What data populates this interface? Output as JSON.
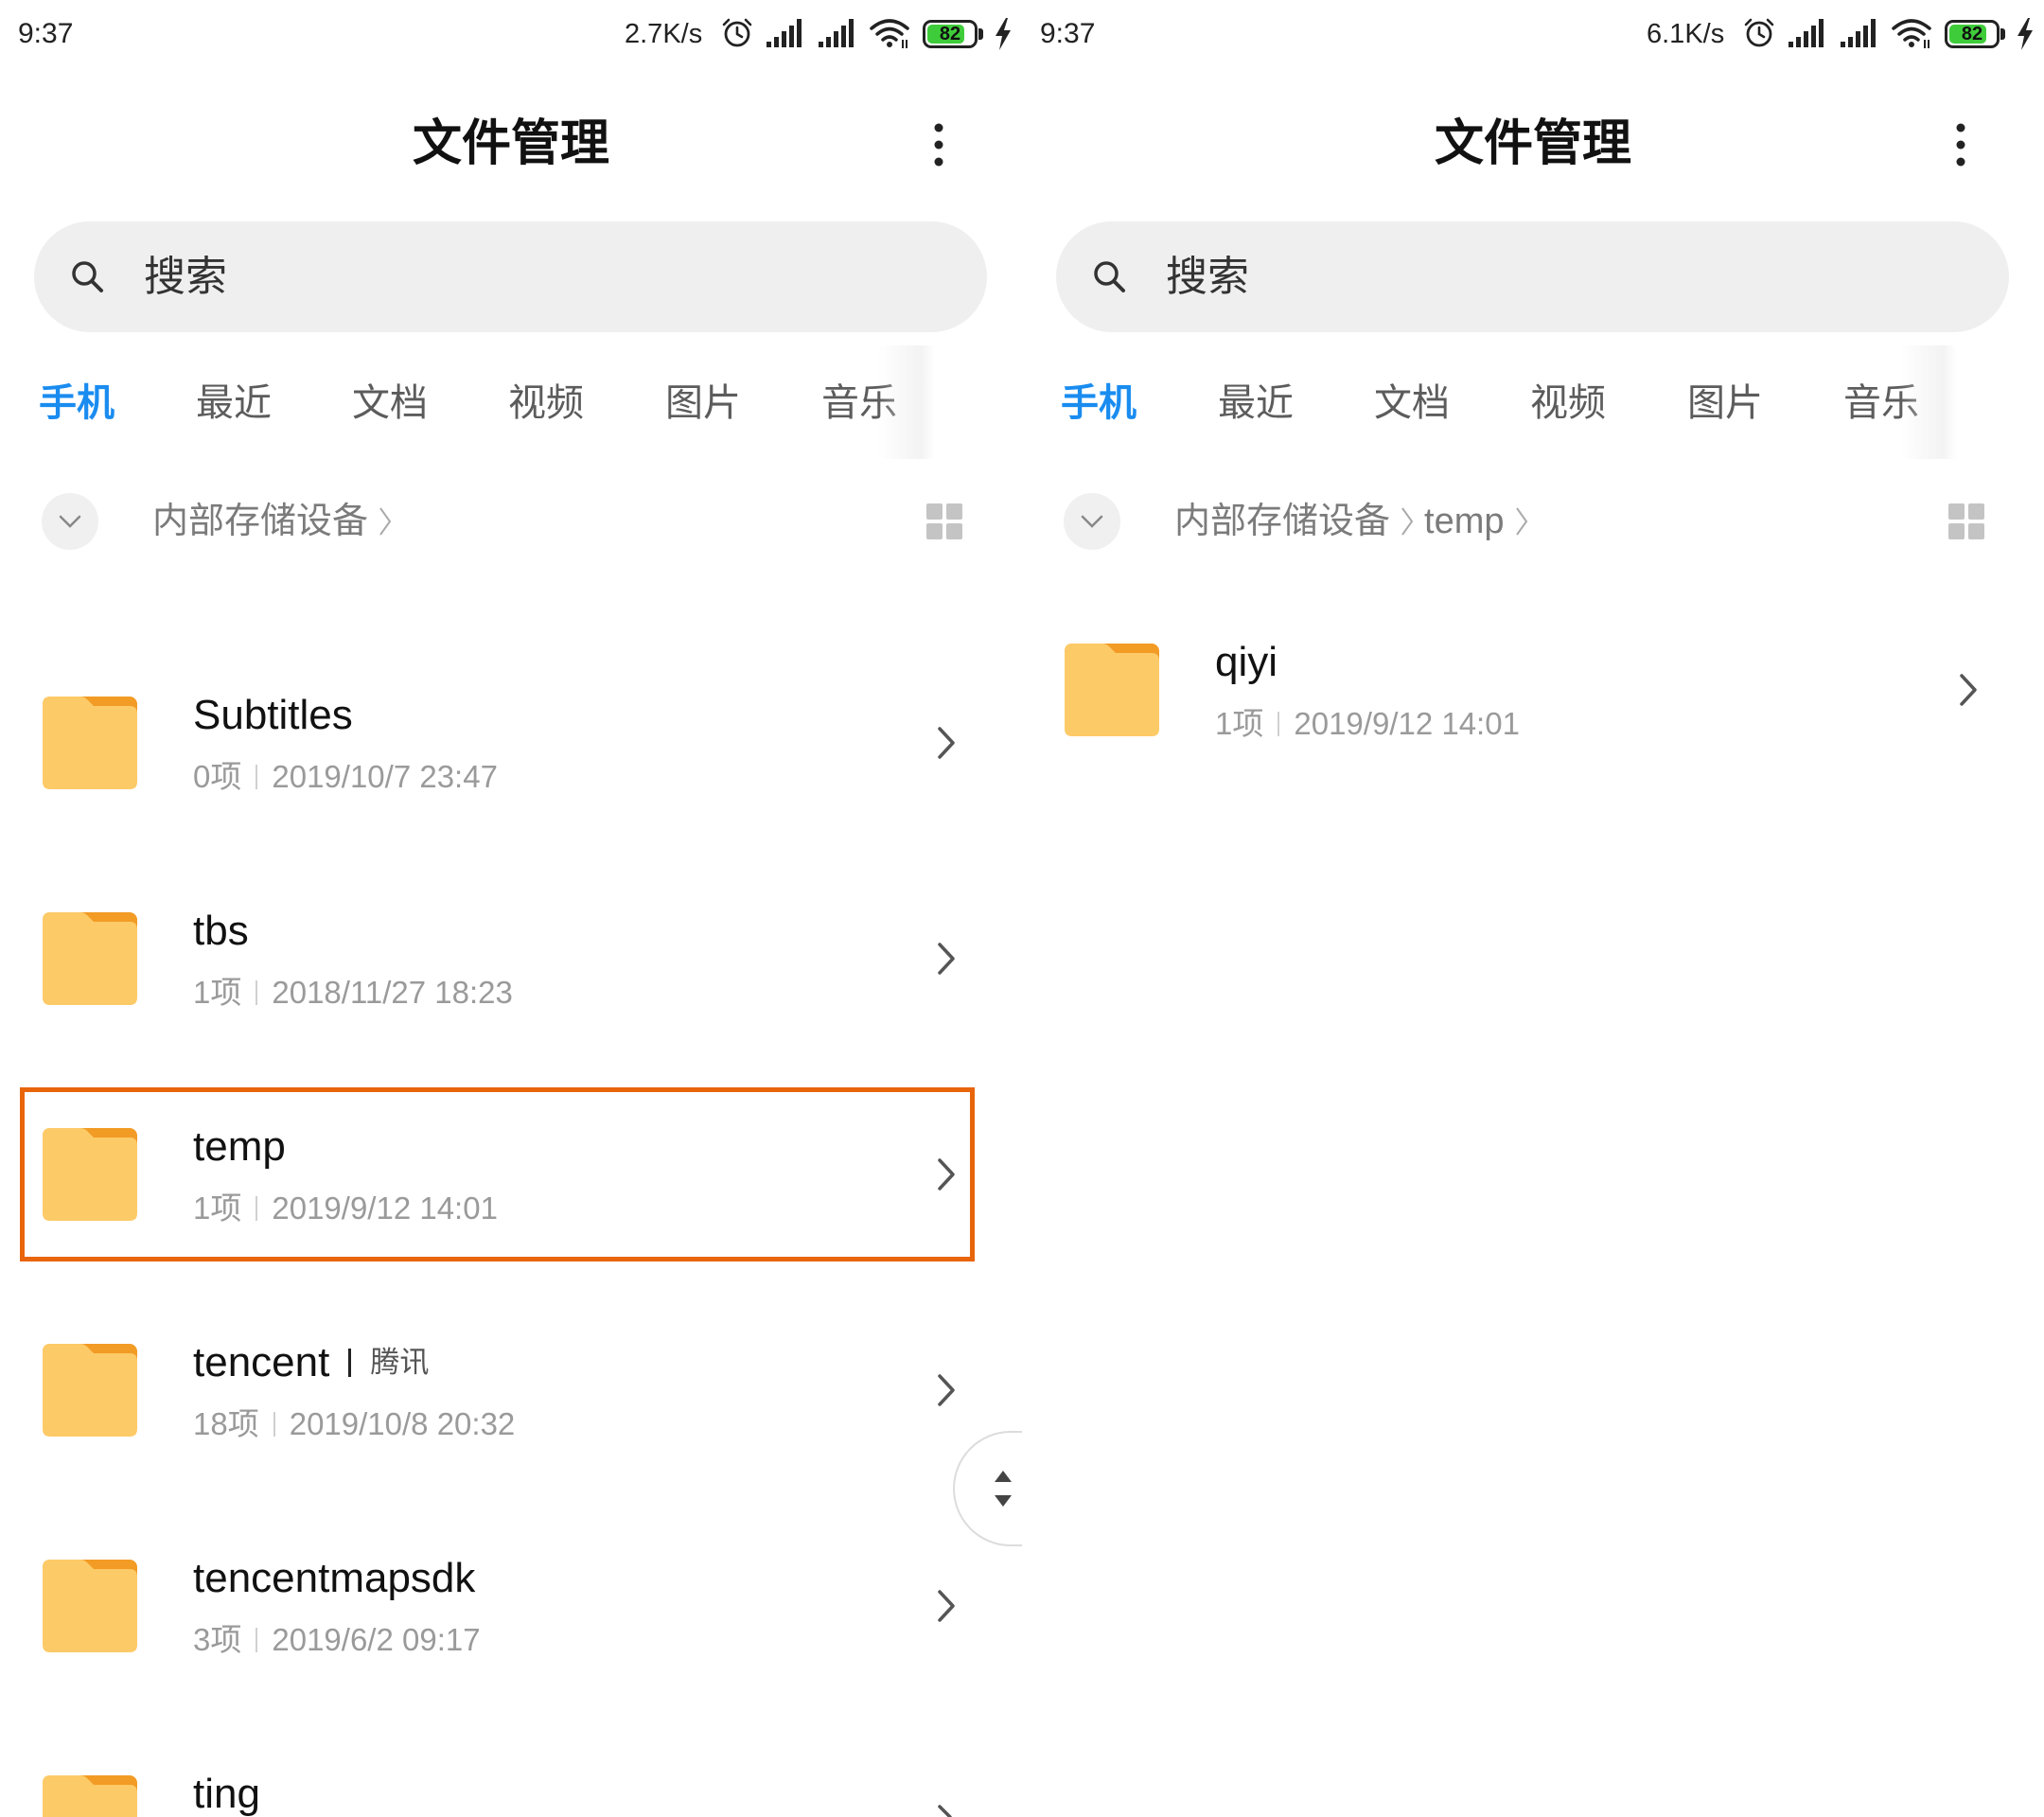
{
  "panels": [
    {
      "status_bar": {
        "time": "9:37",
        "net_speed": "2.7K/s",
        "battery_level": "82"
      },
      "app_bar": {
        "title": "文件管理"
      },
      "search": {
        "placeholder": "搜索"
      },
      "tabs": [
        {
          "label": "手机",
          "active": true
        },
        {
          "label": "最近"
        },
        {
          "label": "文档"
        },
        {
          "label": "视频"
        },
        {
          "label": "图片"
        },
        {
          "label": "音乐"
        }
      ],
      "breadcrumb": [
        "内部存储设备"
      ],
      "items": [
        {
          "name": "Subtitles",
          "count": "0项",
          "modified": "2019/10/7 23:47"
        },
        {
          "name": "tbs",
          "count": "1项",
          "modified": "2018/11/27 18:23"
        },
        {
          "name": "temp",
          "count": "1项",
          "modified": "2019/9/12 14:01",
          "highlighted": true
        },
        {
          "name": "tencent",
          "alias": "腾讯",
          "count": "18项",
          "modified": "2019/10/8 20:32"
        },
        {
          "name": "tencentmapsdk",
          "count": "3项",
          "modified": "2019/6/2 09:17"
        },
        {
          "name": "ting"
        }
      ]
    },
    {
      "status_bar": {
        "time": "9:37",
        "net_speed": "6.1K/s",
        "battery_level": "82"
      },
      "app_bar": {
        "title": "文件管理"
      },
      "search": {
        "placeholder": "搜索"
      },
      "tabs": [
        {
          "label": "手机",
          "active": true
        },
        {
          "label": "最近"
        },
        {
          "label": "文档"
        },
        {
          "label": "视频"
        },
        {
          "label": "图片"
        },
        {
          "label": "音乐"
        }
      ],
      "breadcrumb": [
        "内部存储设备",
        "temp"
      ],
      "items": [
        {
          "name": "qiyi",
          "count": "1项",
          "modified": "2019/9/12 14:01"
        }
      ]
    }
  ],
  "colors": {
    "accent": "#1a8cf0",
    "highlight_border": "#e8650c",
    "folder_body": "#fdca68",
    "folder_tab": "#f29b25",
    "battery_fill": "#3fcc3a",
    "search_bg": "#efefef"
  },
  "icons": [
    "alarm-icon",
    "signal-icon",
    "wifi-icon",
    "battery-icon",
    "charging-icon",
    "more-icon",
    "search-icon",
    "chevron-down-icon",
    "chevron-right-icon",
    "grid-view-icon",
    "folder-icon",
    "scroll-handle-icon"
  ]
}
